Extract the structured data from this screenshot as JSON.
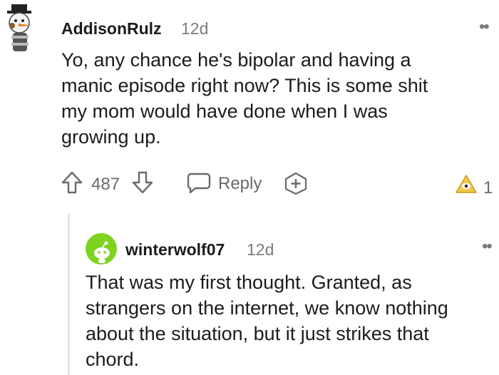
{
  "comments": [
    {
      "username": "AddisonRulz",
      "time": "12d",
      "body_lines": [
        "Yo, any chance he's bipolar and having a",
        "manic episode right now? This is some shit",
        "my mom would have done when I was",
        "growing up."
      ],
      "votes": "487",
      "reply_label": "Reply",
      "award_count": "1",
      "more_icon": "ellipsis-icon"
    },
    {
      "username": "winterwolf07",
      "time": "12d",
      "body_lines": [
        "That was my first thought. Granted, as",
        "strangers on the internet, we know nothing",
        "about the situation, but it just strikes that",
        "chord."
      ],
      "more_icon": "ellipsis-icon"
    }
  ],
  "colors": {
    "text": "#1c1c1c",
    "meta": "#7c7c7c",
    "icon": "#6a6a6a",
    "award_gold": "#f2c94c",
    "avatar_green": "#7ed321"
  }
}
